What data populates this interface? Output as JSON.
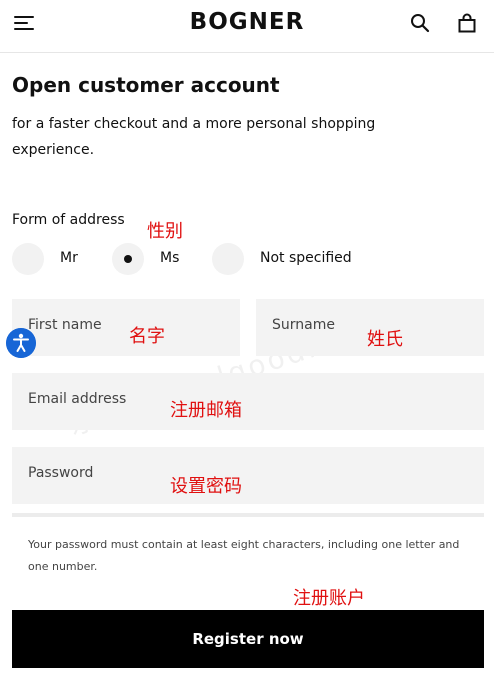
{
  "header": {
    "logo": "BOGNER",
    "menu_icon": "hamburger-icon",
    "search_icon": "search-icon",
    "bag_icon": "shopping-bag-icon"
  },
  "page": {
    "title": "Open customer account",
    "intro": "for a faster checkout and a more personal shopping experience."
  },
  "form": {
    "address_label": "Form of address",
    "salutations": [
      {
        "label": "Mr",
        "selected": false
      },
      {
        "label": "Ms",
        "selected": true
      },
      {
        "label": "Not specified",
        "selected": false
      }
    ],
    "first_name_placeholder": "First name",
    "surname_placeholder": "Surname",
    "email_placeholder": "Email address",
    "password_placeholder": "Password",
    "password_note": "Your password must contain at least eight characters, including one letter and one number.",
    "register_label": "Register now"
  },
  "annotations": {
    "gender": "性别",
    "first_name": "名字",
    "surname": "姓氏",
    "email": "注册邮箱",
    "password": "设置密码",
    "register": "注册账户"
  },
  "watermark": "乐享好物 olgoodbuy.com",
  "colors": {
    "annotation": "#e01010",
    "button": "#000000",
    "field": "#f3f3f3",
    "accessibility": "#1766d6"
  }
}
